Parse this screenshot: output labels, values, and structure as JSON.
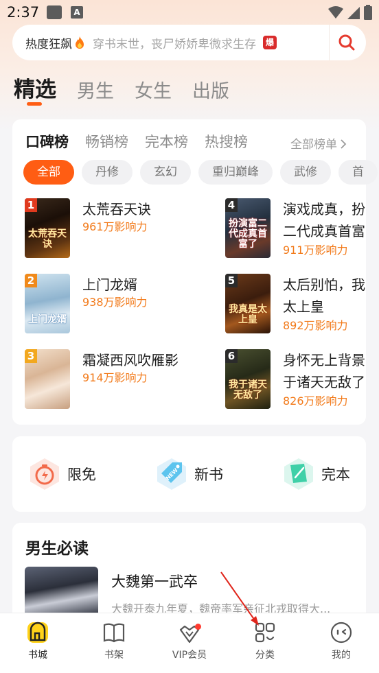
{
  "status_bar": {
    "time": "2:37",
    "notif_letter": "A"
  },
  "search": {
    "hot_label": "热度狂飙",
    "placeholder": "穿书末世，丧尸娇娇卑微求生存",
    "badge": "爆"
  },
  "channel_tabs": [
    {
      "label": "精选",
      "active": true
    },
    {
      "label": "男生"
    },
    {
      "label": "女生"
    },
    {
      "label": "出版"
    }
  ],
  "rank": {
    "tabs": [
      {
        "label": "口碑榜",
        "active": true
      },
      {
        "label": "畅销榜"
      },
      {
        "label": "完本榜"
      },
      {
        "label": "热搜榜"
      }
    ],
    "all_link": "全部榜单",
    "chips": [
      {
        "label": "全部",
        "active": true
      },
      {
        "label": "丹修"
      },
      {
        "label": "玄幻"
      },
      {
        "label": "重归巅峰"
      },
      {
        "label": "武修"
      },
      {
        "label": "首"
      }
    ],
    "books": [
      {
        "rank": "1",
        "title": "太荒吞天诀",
        "meta": "961万影响力",
        "cover_text": "太荒吞天诀"
      },
      {
        "rank": "2",
        "title": "上门龙婿",
        "meta": "938万影响力",
        "cover_text": "上门龙婿"
      },
      {
        "rank": "3",
        "title": "霜凝西风吹雁影",
        "meta": "914万影响力",
        "cover_text": ""
      },
      {
        "rank": "4",
        "title": "演戏成真，扮演富二代成真首富了",
        "title_line1": "演戏成真，扮",
        "title_line2": "二代成真首富",
        "meta": "911万影响力",
        "cover_text": "扮演富二代成真首富了"
      },
      {
        "rank": "5",
        "title": "太后别怕，我真是太上皇",
        "title_line1": "太后别怕，我",
        "title_line2": "太上皇",
        "meta": "892万影响力",
        "cover_text": "我真是太上皇"
      },
      {
        "rank": "6",
        "title": "身怀无上背景，我于诸天无敌了",
        "title_line1": "身怀无上背景",
        "title_line2": "于诸天无敌了",
        "meta": "826万影响力",
        "cover_text": "我于诸天无敌了"
      }
    ]
  },
  "quick": [
    {
      "label": "限免",
      "icon": "stopwatch-icon"
    },
    {
      "label": "新书",
      "icon": "new-tag-icon"
    },
    {
      "label": "完本",
      "icon": "finished-book-icon"
    }
  ],
  "must_read": {
    "title": "男生必读",
    "book_title": "大魏第一武卒",
    "book_desc": "大魏开泰九年夏，魏帝率军亲征北戎取得大..."
  },
  "bottom_nav": [
    {
      "label": "书城",
      "icon": "bookstore-icon",
      "active": true
    },
    {
      "label": "书架",
      "icon": "bookshelf-icon"
    },
    {
      "label": "VIP会员",
      "icon": "vip-crown-icon"
    },
    {
      "label": "分类",
      "icon": "category-grid-icon"
    },
    {
      "label": "我的",
      "icon": "profile-face-icon"
    }
  ],
  "colors": {
    "accent": "#ff5d13",
    "impact": "#f27a1a",
    "badge_red": "#d92b2b"
  }
}
